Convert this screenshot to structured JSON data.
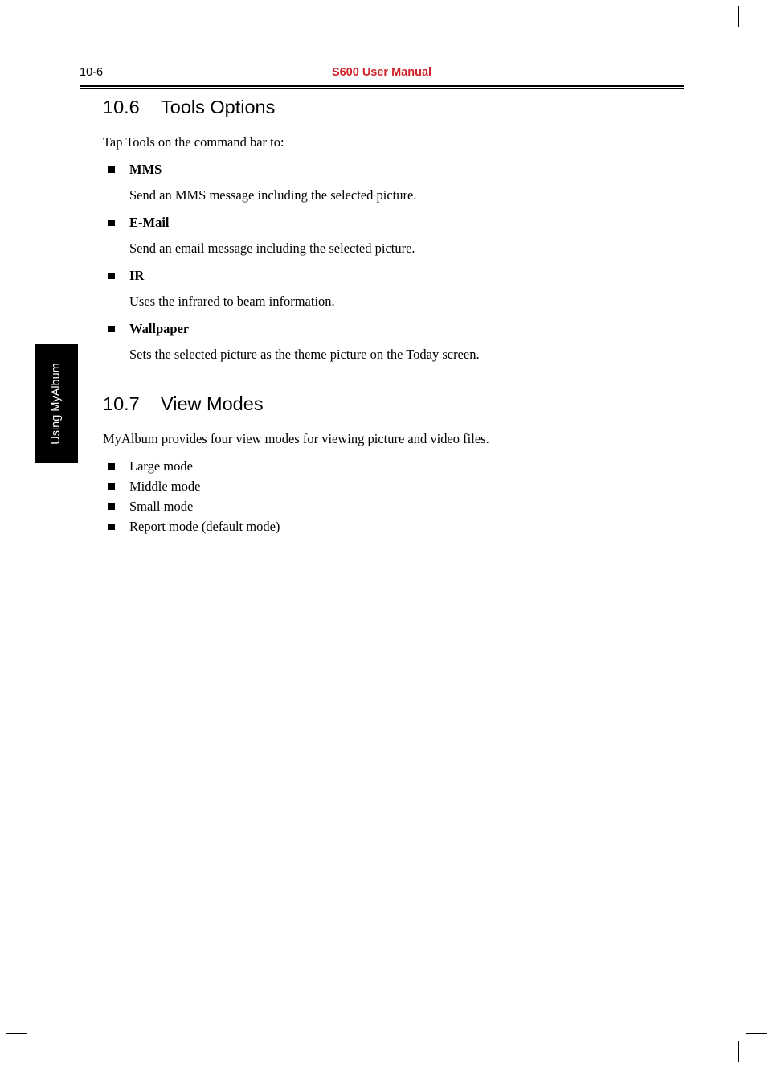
{
  "header": {
    "folio": "10-6",
    "title": "S600 User Manual"
  },
  "side_tab": {
    "label": "Using MyAlbum"
  },
  "sections": [
    {
      "number": "10.6",
      "title": "Tools Options",
      "intro": "Tap Tools on the command bar to:",
      "items": [
        {
          "term": "MMS",
          "desc": "Send an MMS message including the selected picture."
        },
        {
          "term": "E-Mail",
          "desc": "Send an email message including the selected picture."
        },
        {
          "term": "IR",
          "desc": "Uses the infrared to beam information."
        },
        {
          "term": "Wallpaper",
          "desc": "Sets the selected picture as the theme picture on the Today screen."
        }
      ]
    },
    {
      "number": "10.7",
      "title": "View Modes",
      "intro": "MyAlbum provides four view modes for viewing picture and video files.",
      "list": [
        "Large mode",
        "Middle mode",
        "Small mode",
        "Report mode (default mode)"
      ]
    }
  ]
}
